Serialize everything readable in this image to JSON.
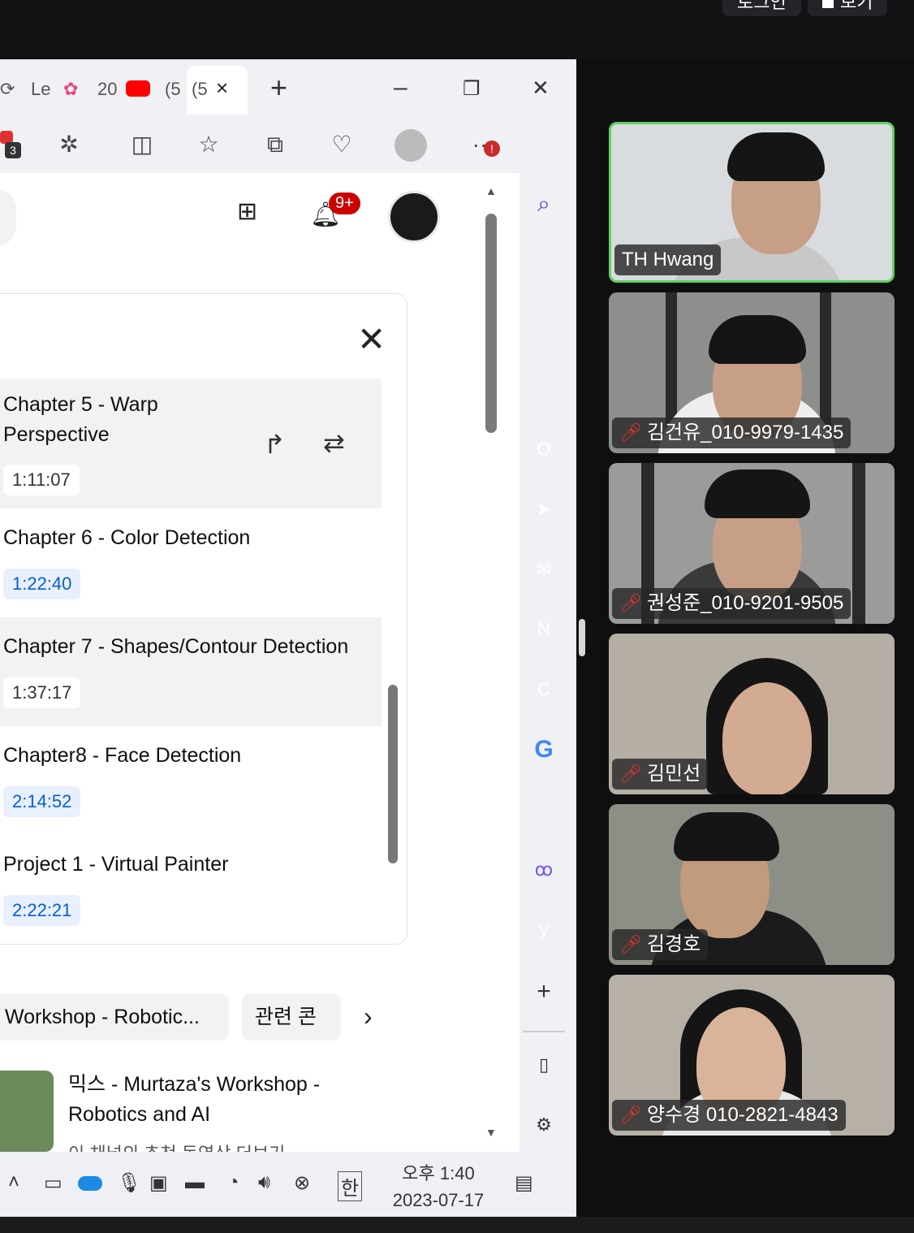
{
  "zoom": {
    "top_buttons": [
      "로그인",
      "보기"
    ],
    "participants": [
      {
        "name": "TH Hwang",
        "muted": false,
        "speaking": true
      },
      {
        "name": "김건유_010-9979-1435",
        "muted": true,
        "speaking": false
      },
      {
        "name": "권성준_010-9201-9505",
        "muted": true,
        "speaking": false
      },
      {
        "name": "김민선",
        "muted": true,
        "speaking": false
      },
      {
        "name": "김경호",
        "muted": true,
        "speaking": false
      },
      {
        "name": "양수경 010-2821-4843",
        "muted": true,
        "speaking": false
      }
    ],
    "mute_icon": "mic-muted-icon",
    "speaking_border_color": "#5fd35f"
  },
  "browser": {
    "tabs": [
      "Le",
      "20",
      "(5",
      "(5"
    ],
    "active_tab_close": "×",
    "new_tab": "+",
    "window_controls": {
      "minimize": "–",
      "restore": "❐",
      "close": "✕"
    },
    "toolbar_badge": "3",
    "more_badge": "!",
    "header": {
      "notification_badge": "9+"
    },
    "chapters": [
      {
        "title": "Chapter 5 - Warp Perspective",
        "time": "1:11:07",
        "active": true
      },
      {
        "title": "Chapter 6 - Color Detection",
        "time": "1:22:40",
        "active": false
      },
      {
        "title": "Chapter 7 - Shapes/Contour Detection",
        "time": "1:37:17",
        "active": true
      },
      {
        "title": "Chapter8 - Face Detection",
        "time": "2:14:52",
        "active": false
      },
      {
        "title": "Project 1 - Virtual Painter",
        "time": "2:22:21",
        "active": false
      }
    ],
    "chips": [
      "Workshop - Robotic...",
      "관련 콘"
    ],
    "recommendation": {
      "title": "믹스 - Murtaza's Workshop - Robotics and AI",
      "subtitle": "이 채널의 추천 동영상 더보기"
    },
    "sidebar_colors": [
      "#4c6ef5",
      "#f76707",
      "#845ef7",
      "#0b74d1",
      "#339af0",
      "#e64980",
      "#2f9e44",
      "#111111",
      "#4285f4",
      "#9775fa",
      "#7950f2",
      "#111111"
    ]
  },
  "taskbar": {
    "ime": "한",
    "time": "오후 1:40",
    "date": "2023-07-17"
  }
}
